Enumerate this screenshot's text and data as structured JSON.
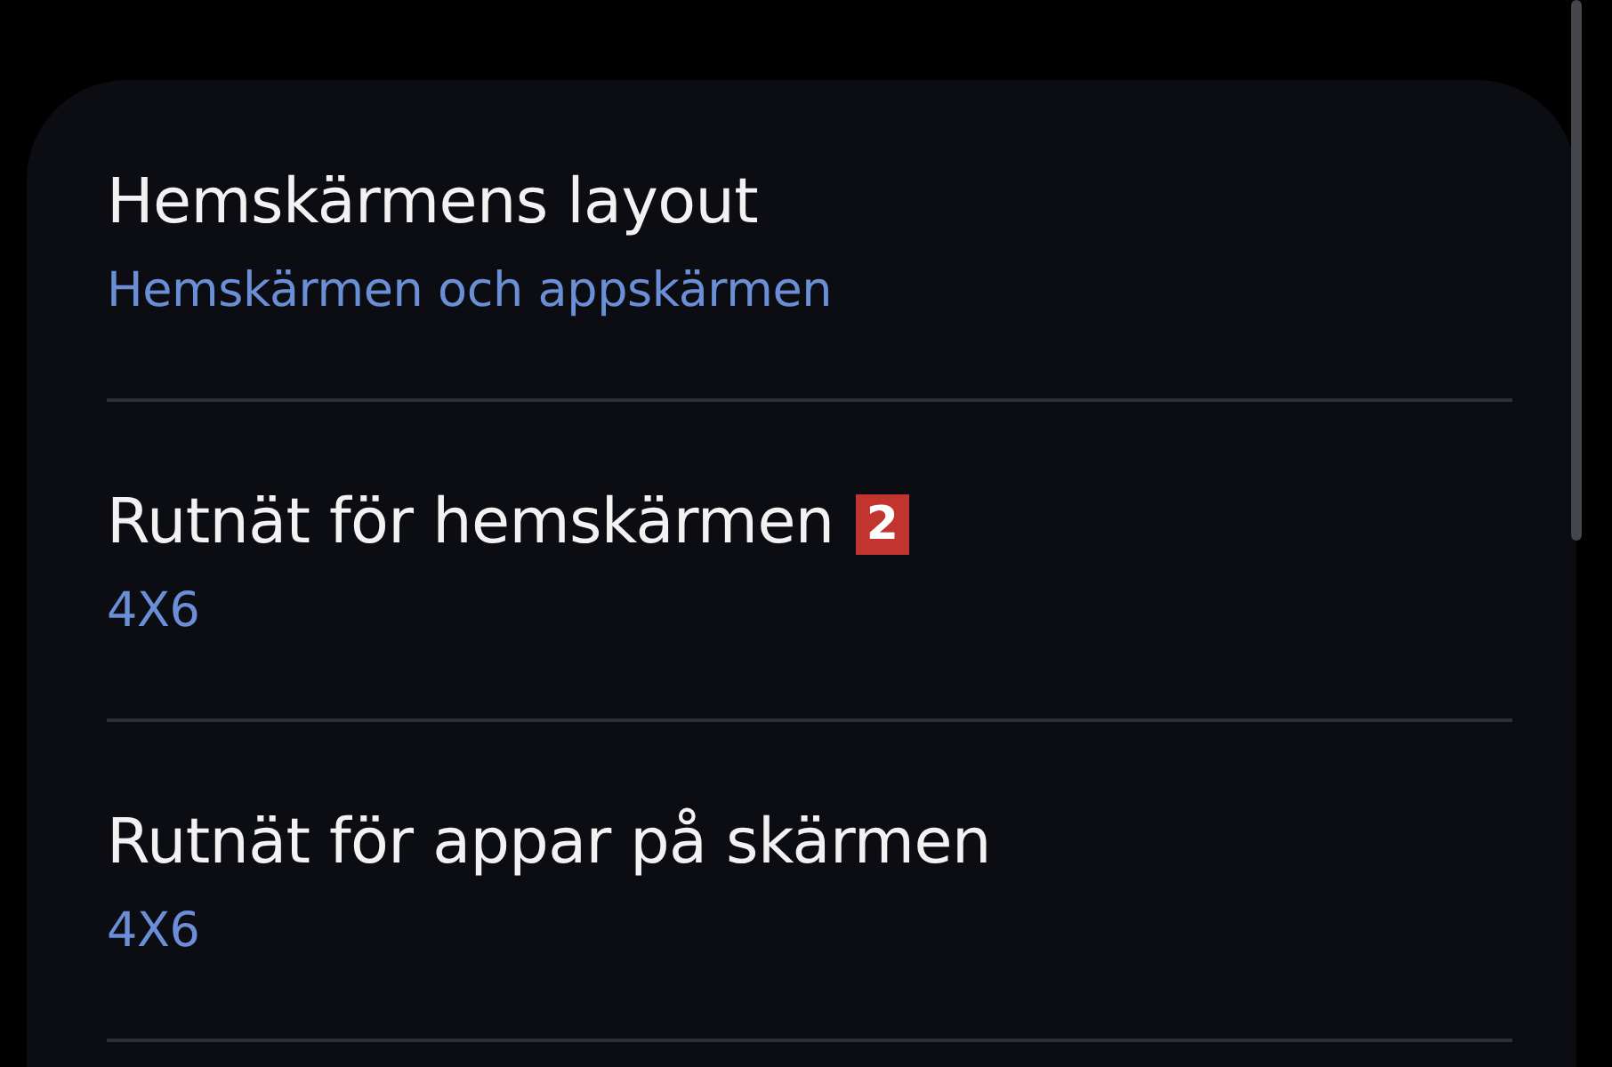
{
  "settings": [
    {
      "title": "Hemskärmens layout",
      "value": "Hemskärmen och appskärmen"
    },
    {
      "title": "Rutnät för hemskärmen",
      "value": "4X6",
      "badge": "2"
    },
    {
      "title": "Rutnät för appar på skärmen",
      "value": "4X6"
    }
  ]
}
